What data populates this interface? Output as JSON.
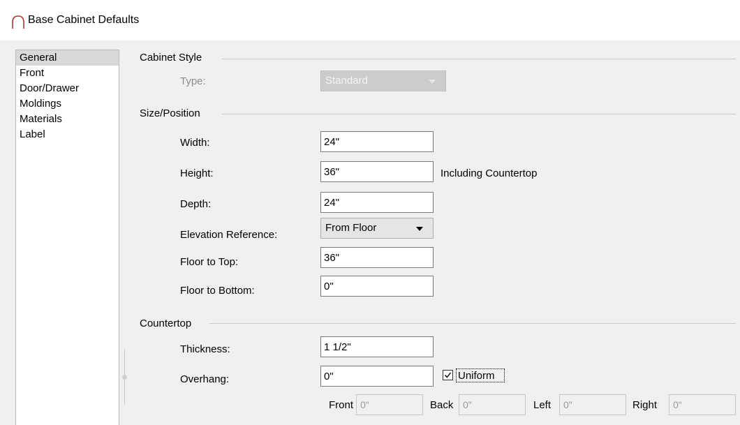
{
  "window": {
    "title": "Base Cabinet Defaults"
  },
  "nav": {
    "items": [
      "General",
      "Front",
      "Door/Drawer",
      "Moldings",
      "Materials",
      "Label"
    ],
    "selected": "General"
  },
  "cabinet_style": {
    "title": "Cabinet Style",
    "type_label": "Type:",
    "type_value": "Standard"
  },
  "size_position": {
    "title": "Size/Position",
    "width_label": "Width:",
    "width_value": "24\"",
    "height_label": "Height:",
    "height_value": "36\"",
    "height_note": "Including Countertop",
    "depth_label": "Depth:",
    "depth_value": "24\"",
    "elevation_label": "Elevation Reference:",
    "elevation_value": "From Floor",
    "floor_top_label": "Floor to Top:",
    "floor_top_value": "36\"",
    "floor_bottom_label": "Floor to Bottom:",
    "floor_bottom_value": "0\""
  },
  "countertop": {
    "title": "Countertop",
    "thickness_label": "Thickness:",
    "thickness_value": "1 1/2\"",
    "overhang_label": "Overhang:",
    "overhang_value": "0\"",
    "uniform_label": "Uniform",
    "uniform_checked": true,
    "front_label": "Front",
    "front_value": "0\"",
    "back_label": "Back",
    "back_value": "0\"",
    "left_label": "Left",
    "left_value": "0\"",
    "right_label": "Right",
    "right_value": "0\""
  }
}
